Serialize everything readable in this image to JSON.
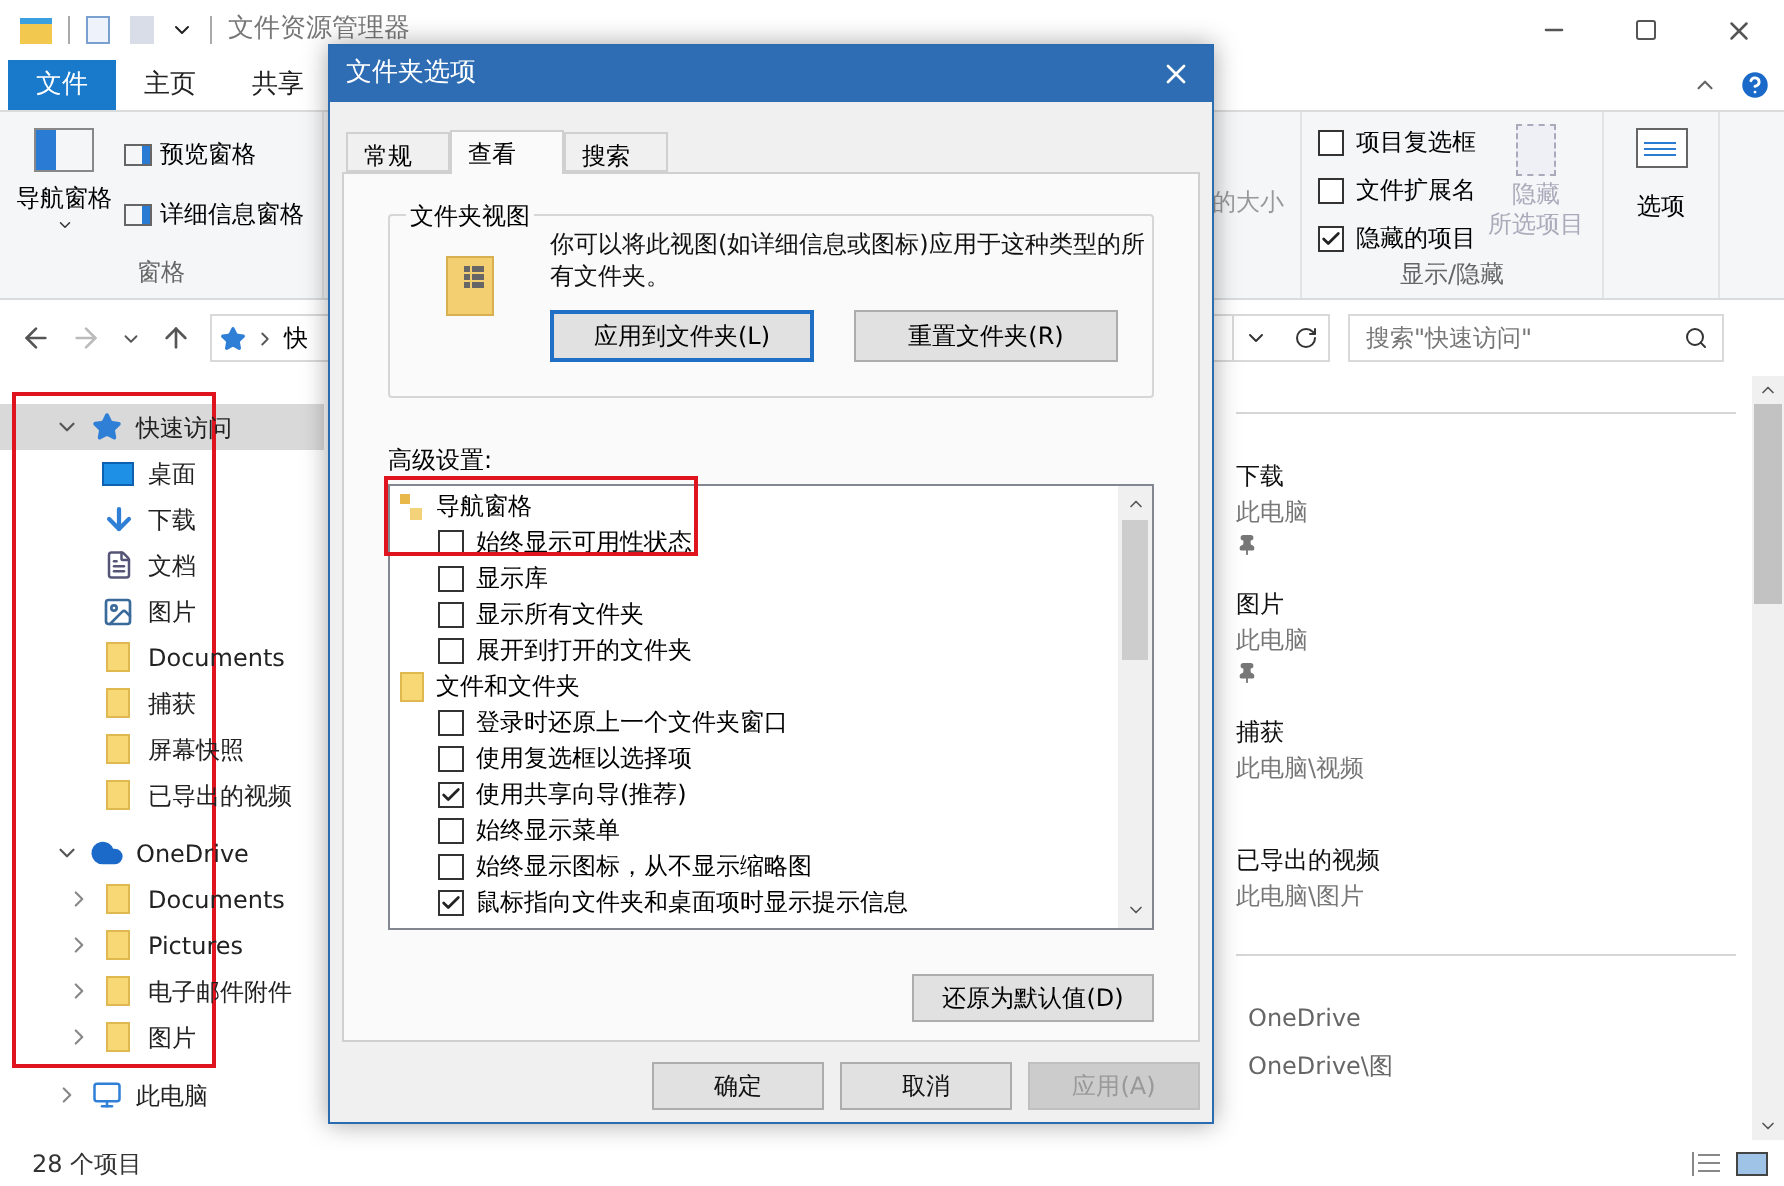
{
  "window": {
    "title": "文件资源管理器"
  },
  "ribbon_tabs": [
    {
      "label": "文件",
      "selected": true
    },
    {
      "label": "主页",
      "selected": false
    },
    {
      "label": "共享",
      "selected": false
    }
  ],
  "ribbon": {
    "panes": {
      "nav_pane": "导航窗格",
      "preview_pane": "预览窗格",
      "details_pane": "详细信息窗格",
      "label": "窗格"
    },
    "partial_label": "的大小",
    "show_hide": {
      "options": [
        {
          "label": "项目复选框",
          "checked": false
        },
        {
          "label": "文件扩展名",
          "checked": false
        },
        {
          "label": "隐藏的项目",
          "checked": true
        }
      ],
      "hide_selected": {
        "lines": [
          "隐藏",
          "所选项目"
        ],
        "disabled": true
      },
      "label": "显示/隐藏"
    },
    "options_button": "选项"
  },
  "address": {
    "crumb": "快",
    "search": {
      "placeholder": "搜索\"快速访问\""
    }
  },
  "nav": [
    {
      "label": "快速访问",
      "kind": "star",
      "expanded": true,
      "selected": true,
      "children": [
        {
          "label": "桌面",
          "kind": "desktop",
          "selected": false
        },
        {
          "label": "下载",
          "kind": "download",
          "selected": false
        },
        {
          "label": "文档",
          "kind": "document",
          "selected": false
        },
        {
          "label": "图片",
          "kind": "picture",
          "selected": false
        },
        {
          "label": "Documents",
          "kind": "folder",
          "selected": false
        },
        {
          "label": "捕获",
          "kind": "folder",
          "selected": false
        },
        {
          "label": "屏幕快照",
          "kind": "folder",
          "selected": false
        },
        {
          "label": "已导出的视频",
          "kind": "folder",
          "selected": false
        }
      ]
    },
    {
      "label": "OneDrive",
      "kind": "cloud",
      "expanded": true,
      "selected": false,
      "children": [
        {
          "label": "Documents",
          "kind": "folder",
          "expanded": false,
          "selected": false
        },
        {
          "label": "Pictures",
          "kind": "folder",
          "expanded": false,
          "selected": false
        },
        {
          "label": "电子邮件附件",
          "kind": "folder",
          "expanded": false,
          "selected": false
        },
        {
          "label": "图片",
          "kind": "folder",
          "expanded": false,
          "selected": false
        }
      ]
    },
    {
      "label": "此电脑",
      "kind": "pc",
      "expanded": false,
      "selected": false
    }
  ],
  "content": {
    "items": [
      {
        "name": "下载",
        "location": "此电脑",
        "pinned": true
      },
      {
        "name": "图片",
        "location": "此电脑",
        "pinned": true
      },
      {
        "name": "捕获",
        "location": "此电脑\\视频",
        "pinned": false
      },
      {
        "name": "已导出的视频",
        "location": "此电脑\\图片",
        "pinned": false
      }
    ],
    "recent": [
      "OneDrive",
      "OneDrive\\图"
    ]
  },
  "status_bar": {
    "count": "28 个项目"
  },
  "dialog": {
    "title": "文件夹选项",
    "tabs": [
      {
        "label": "常规",
        "selected": false
      },
      {
        "label": "查看",
        "selected": true
      },
      {
        "label": "搜索",
        "selected": false
      }
    ],
    "folder_views": {
      "title": "文件夹视图",
      "description": "你可以将此视图(如详细信息或图标)应用于这种类型的所有文件夹。",
      "buttons": [
        {
          "label": "应用到文件夹(L)",
          "focused": true
        },
        {
          "label": "重置文件夹(R)",
          "focused": false
        }
      ]
    },
    "advanced": {
      "label": "高级设置:",
      "items": [
        {
          "kind": "pane",
          "label": "导航窗格"
        },
        {
          "kind": "check",
          "label": "始终显示可用性状态",
          "checked": false
        },
        {
          "kind": "check",
          "label": "显示库",
          "checked": false
        },
        {
          "kind": "check",
          "label": "显示所有文件夹",
          "checked": false
        },
        {
          "kind": "check",
          "label": "展开到打开的文件夹",
          "checked": false
        },
        {
          "kind": "folder",
          "label": "文件和文件夹"
        },
        {
          "kind": "check",
          "label": "登录时还原上一个文件夹窗口",
          "checked": false
        },
        {
          "kind": "check",
          "label": "使用复选框以选择项",
          "checked": false
        },
        {
          "kind": "check",
          "label": "使用共享向导(推荐)",
          "checked": true
        },
        {
          "kind": "check",
          "label": "始终显示菜单",
          "checked": false
        },
        {
          "kind": "check",
          "label": "始终显示图标，从不显示缩略图",
          "checked": false
        },
        {
          "kind": "check",
          "label": "鼠标指向文件夹和桌面项时显示提示信息",
          "checked": true
        }
      ]
    },
    "restore_button": "还原为默认值(D)",
    "buttons": [
      {
        "label": "确定",
        "disabled": false
      },
      {
        "label": "取消",
        "disabled": false
      },
      {
        "label": "应用(A)",
        "disabled": true
      }
    ]
  }
}
